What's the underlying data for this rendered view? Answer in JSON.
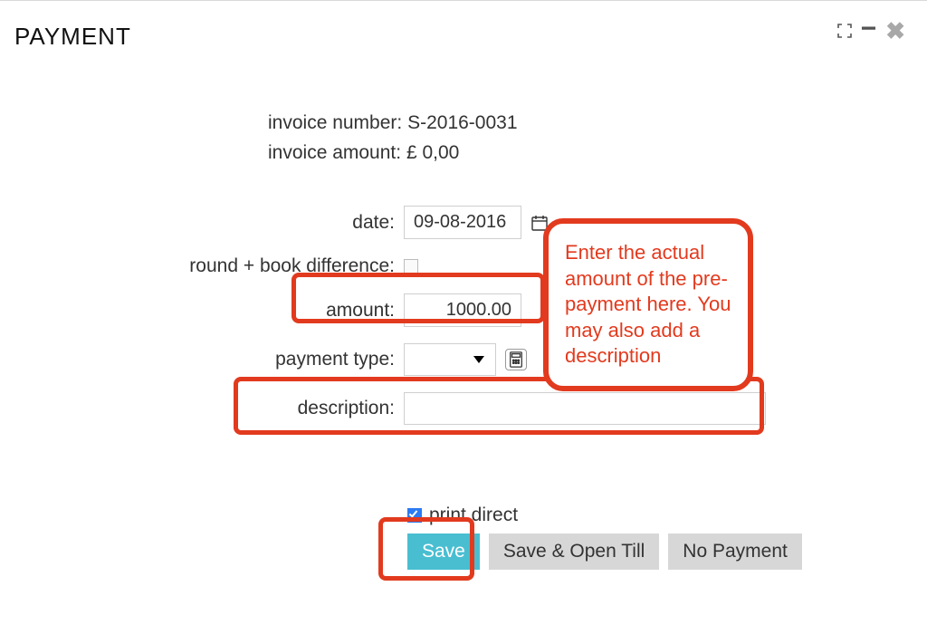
{
  "window": {
    "title": "PAYMENT"
  },
  "info": {
    "invoice_number_label": "invoice number:",
    "invoice_number_value": "S-2016-0031",
    "invoice_amount_label": "invoice amount:",
    "invoice_amount_value": "£ 0,00"
  },
  "form": {
    "date_label": "date:",
    "date_value": "09-08-2016",
    "round_label": "round + book difference:",
    "amount_label": "amount:",
    "amount_value": "1000.00",
    "payment_type_label": "payment type:",
    "description_label": "description:",
    "description_value": ""
  },
  "print": {
    "label": "print direct",
    "checked": true
  },
  "buttons": {
    "save": "Save",
    "save_open_till": "Save & Open Till",
    "no_payment": "No Payment"
  },
  "callout": {
    "text": "Enter the actual amount of the pre-payment here. You may also add a description"
  }
}
